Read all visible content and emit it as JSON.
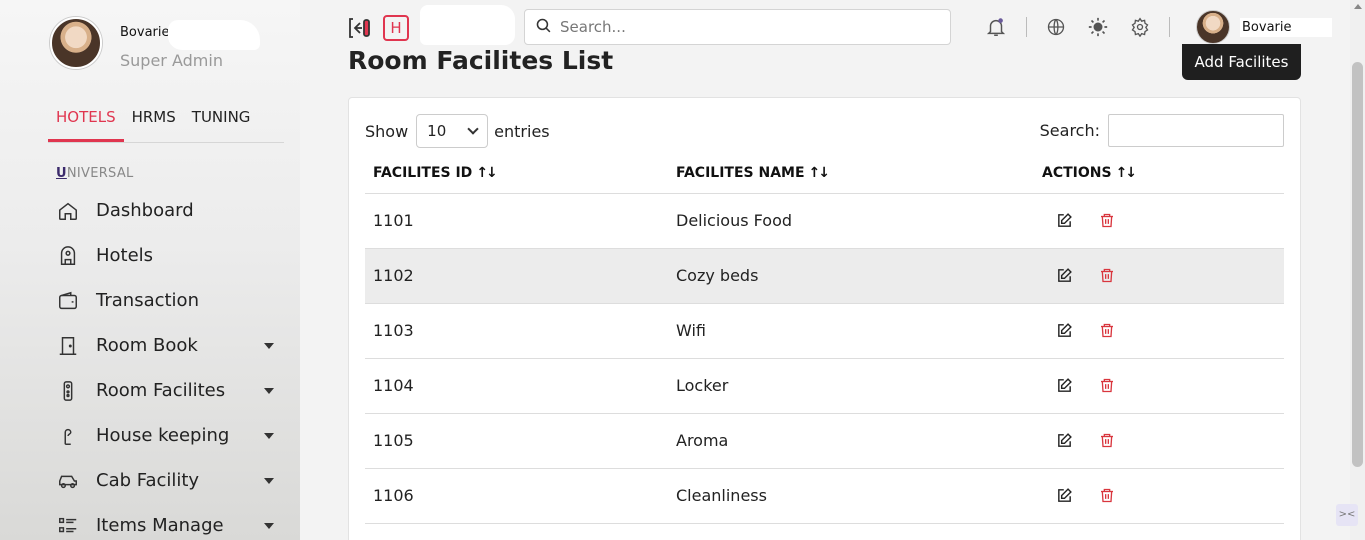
{
  "profile": {
    "name": "Bovarie",
    "role": "Super Admin"
  },
  "tabs": [
    {
      "label": "HOTELS",
      "active": true
    },
    {
      "label": "HRMS",
      "active": false
    },
    {
      "label": "TUNING",
      "active": false
    }
  ],
  "section": {
    "first_letter": "U",
    "rest": "NIVERSAL"
  },
  "nav": [
    {
      "label": "Dashboard",
      "icon": "home-icon",
      "has_caret": false
    },
    {
      "label": "Hotels",
      "icon": "hotel-icon",
      "has_caret": false
    },
    {
      "label": "Transaction",
      "icon": "wallet-icon",
      "has_caret": false
    },
    {
      "label": "Room Book",
      "icon": "door-icon",
      "has_caret": true
    },
    {
      "label": "Room Facilites",
      "icon": "remote-icon",
      "has_caret": true
    },
    {
      "label": "House keeping",
      "icon": "hanger-icon",
      "has_caret": true
    },
    {
      "label": "Cab Facility",
      "icon": "car-icon",
      "has_caret": true
    },
    {
      "label": "Items Manage",
      "icon": "list-icon",
      "has_caret": true
    }
  ],
  "header": {
    "logo_letter": "H",
    "search_placeholder": "Search...",
    "user_name": "Bovarie"
  },
  "page": {
    "title": "Room Facilites List",
    "add_button": "Add Facilites"
  },
  "table_controls": {
    "show_label": "Show",
    "entries_value": "10",
    "entries_label": "entries",
    "search_label": "Search:"
  },
  "table": {
    "columns": [
      "FACILITES ID",
      "FACILITES NAME",
      "ACTIONS"
    ],
    "sort_glyph": "↑↓",
    "rows": [
      {
        "id": "1101",
        "name": "Delicious Food"
      },
      {
        "id": "1102",
        "name": "Cozy beds"
      },
      {
        "id": "1103",
        "name": "Wifi"
      },
      {
        "id": "1104",
        "name": "Locker"
      },
      {
        "id": "1105",
        "name": "Aroma"
      },
      {
        "id": "1106",
        "name": "Cleanliness"
      }
    ]
  },
  "colors": {
    "accent": "#e0354f",
    "delete": "#d9363e",
    "button_dark": "#1f1f1f"
  }
}
